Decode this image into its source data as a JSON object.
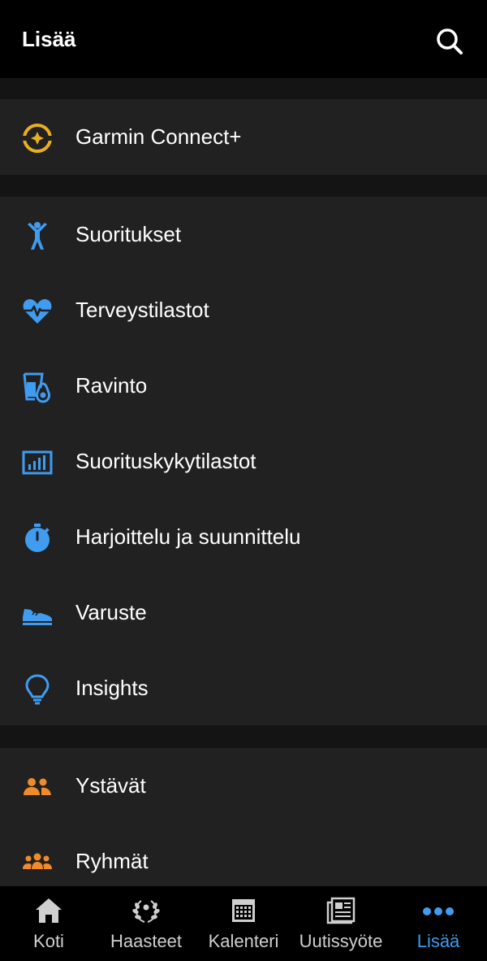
{
  "header": {
    "title": "Lisää",
    "search_icon": "search-icon"
  },
  "colors": {
    "header_bg": "#000000",
    "section_bg": "#212121",
    "divider_bg": "#141414",
    "accent_blue": "#3f9cf0",
    "accent_orange": "#f08a2a",
    "garmin_gold": "#e8b01e"
  },
  "sections": {
    "premium": {
      "items": [
        {
          "label": "Garmin Connect+",
          "icon": "garmin-connect-plus-icon"
        }
      ]
    },
    "main": {
      "items": [
        {
          "label": "Suoritukset",
          "icon": "running-person-icon"
        },
        {
          "label": "Terveystilastot",
          "icon": "heart-pulse-icon"
        },
        {
          "label": "Ravinto",
          "icon": "nutrition-icon"
        },
        {
          "label": "Suorituskykytilastot",
          "icon": "bar-chart-icon"
        },
        {
          "label": "Harjoittelu ja suunnittelu",
          "icon": "stopwatch-icon"
        },
        {
          "label": "Varuste",
          "icon": "shoe-icon"
        },
        {
          "label": "Insights",
          "icon": "lightbulb-icon"
        }
      ]
    },
    "social": {
      "items": [
        {
          "label": "Ystävät",
          "icon": "friends-icon"
        },
        {
          "label": "Ryhmät",
          "icon": "groups-icon"
        }
      ]
    }
  },
  "tabbar": {
    "tabs": [
      {
        "label": "Koti",
        "icon": "home-icon",
        "active": false
      },
      {
        "label": "Haasteet",
        "icon": "laurel-icon",
        "active": false
      },
      {
        "label": "Kalenteri",
        "icon": "calendar-icon",
        "active": false
      },
      {
        "label": "Uutissyöte",
        "icon": "newsfeed-icon",
        "active": false
      },
      {
        "label": "Lisää",
        "icon": "more-dots-icon",
        "active": true
      }
    ]
  }
}
